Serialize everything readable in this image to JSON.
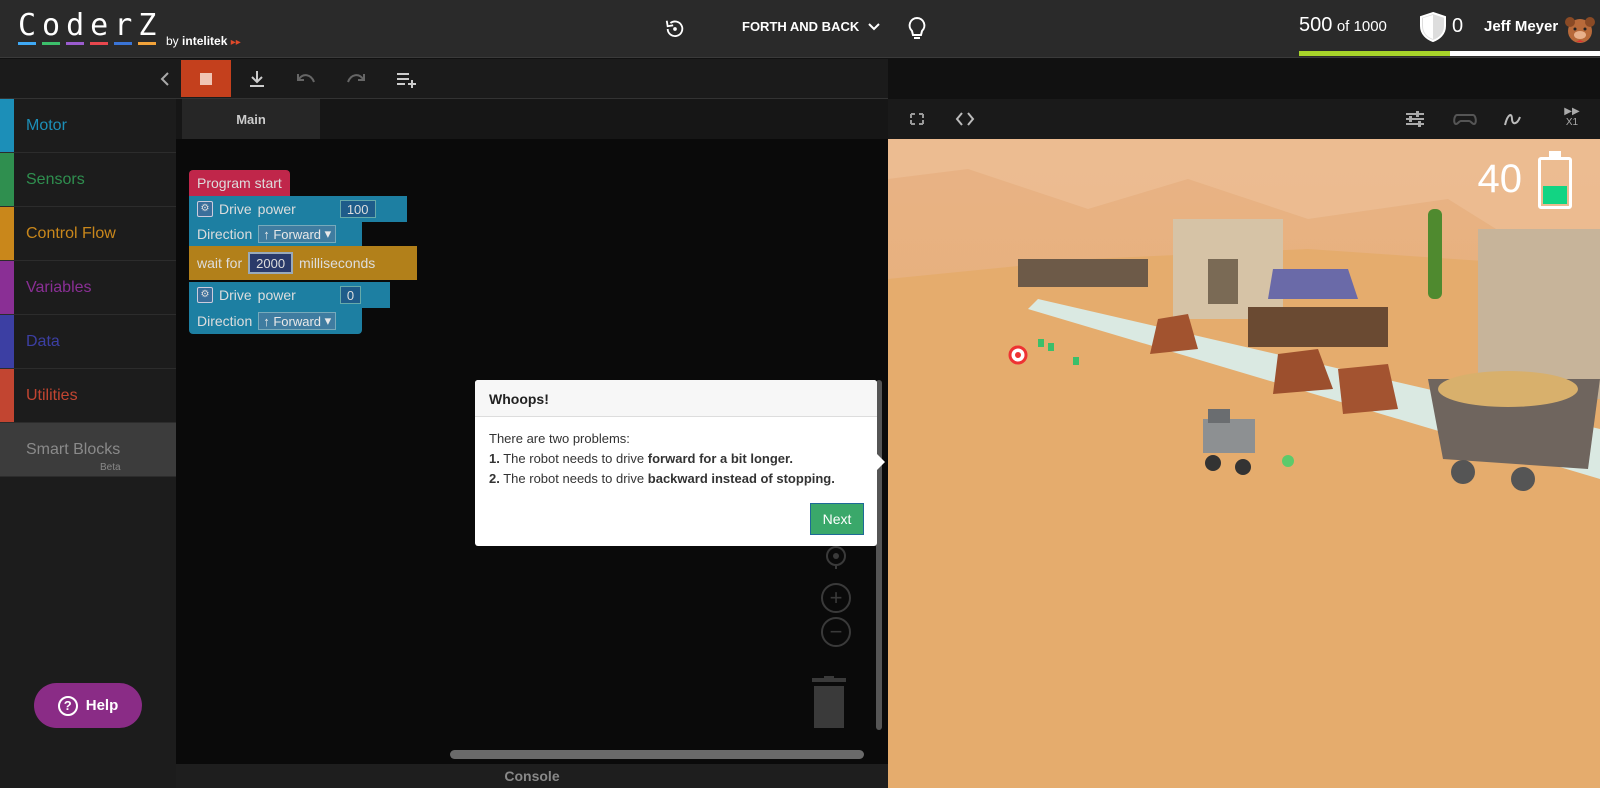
{
  "header": {
    "logo_text": "CoderZ",
    "logo_by": "by",
    "logo_brand": "intelitek",
    "logo_colors": [
      "#3fa9f5",
      "#3cbf6b",
      "#9b5ccf",
      "#e8474e",
      "#3a74d6",
      "#f2a33a"
    ],
    "mission_title": "FORTH AND BACK",
    "score_current": "500",
    "score_of": "of 1000",
    "score_fraction": 0.5,
    "shield_count": "0",
    "username": "Jeff Meyer"
  },
  "sidebar": {
    "categories": [
      {
        "label": "Motor",
        "color": "#1c8fb8"
      },
      {
        "label": "Sensors",
        "color": "#2f8f4f"
      },
      {
        "label": "Control Flow",
        "color": "#c9871b"
      },
      {
        "label": "Variables",
        "color": "#8a2f95"
      },
      {
        "label": "Data",
        "color": "#3c3fa3"
      },
      {
        "label": "Utilities",
        "color": "#c24531"
      }
    ],
    "smart_blocks": "Smart Blocks",
    "beta": "Beta",
    "help": "Help"
  },
  "workspace": {
    "tab": "Main",
    "console": "Console"
  },
  "blocks": {
    "program_start": "Program start",
    "drive1": {
      "drive": "Drive",
      "power": "power",
      "value": "100",
      "direction": "Direction",
      "dir_value": "↑ Forward"
    },
    "wait": {
      "label": "wait for",
      "value": "2000",
      "unit": "milliseconds"
    },
    "drive2": {
      "drive": "Drive",
      "power": "power",
      "value": "0",
      "direction": "Direction",
      "dir_value": "↑ Forward"
    }
  },
  "dialog": {
    "title": "Whoops!",
    "intro": "There are two problems:",
    "p1_num": "1.",
    "p1_text": "The robot needs to drive",
    "p1_bold": "forward for a bit longer.",
    "p2_num": "2.",
    "p2_text": "The robot needs to drive",
    "p2_bold": "backward instead of stopping.",
    "next": "Next"
  },
  "simulation": {
    "battery_value": "40",
    "battery_fraction": 0.4,
    "speed_label": "X1"
  }
}
